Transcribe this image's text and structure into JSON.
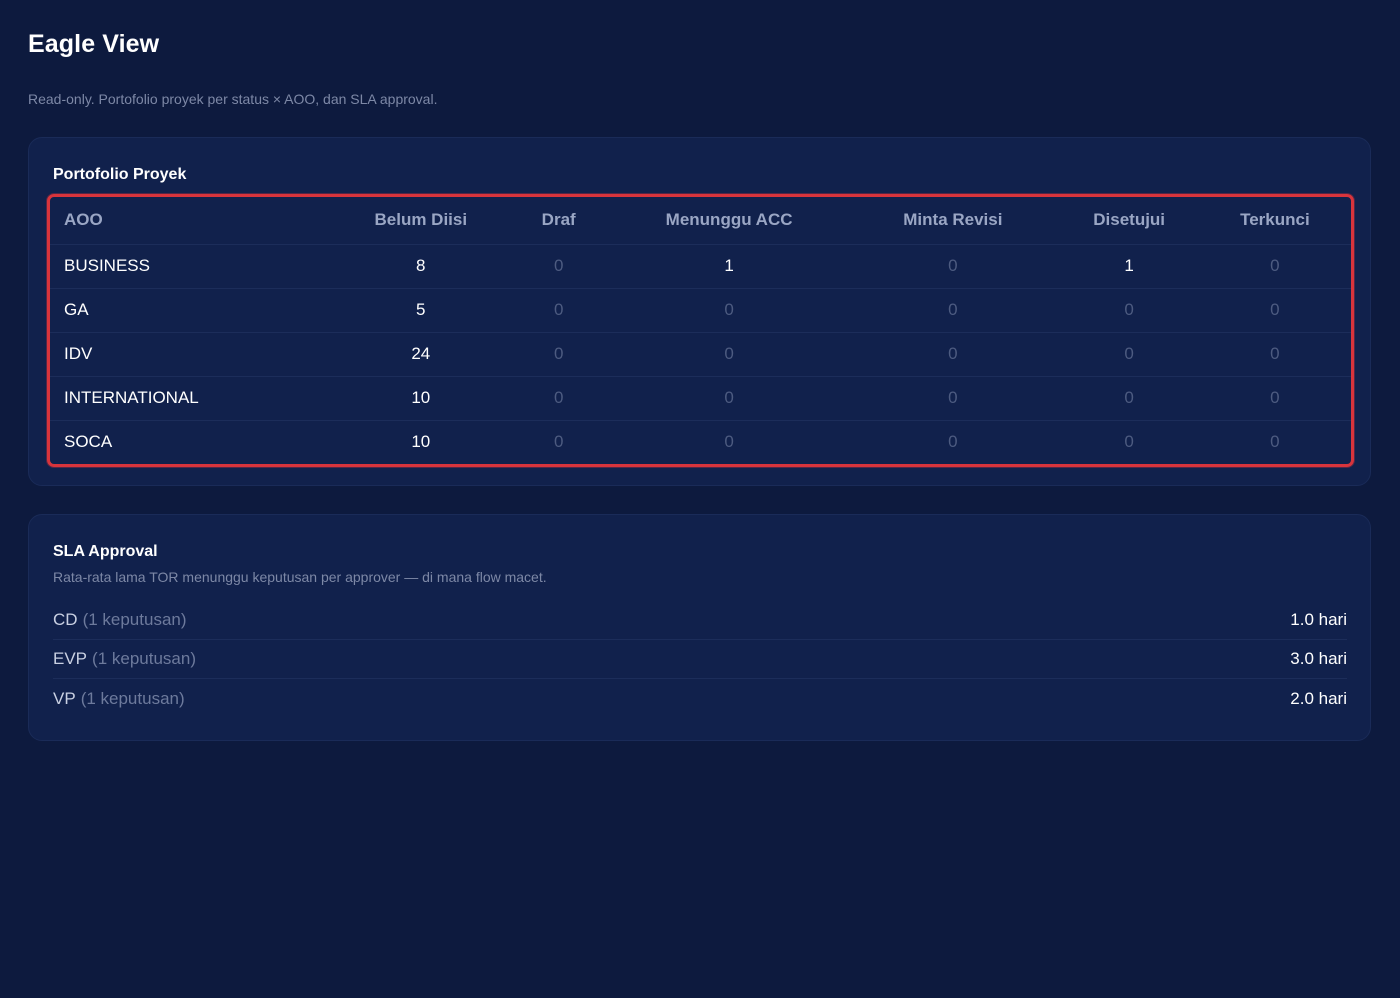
{
  "page": {
    "title": "Eagle View",
    "subtitle": "Read-only. Portofolio proyek per status × AOO, dan SLA approval."
  },
  "portfolio": {
    "title": "Portofolio Proyek",
    "columns": [
      "AOO",
      "Belum Diisi",
      "Draf",
      "Menunggu ACC",
      "Minta Revisi",
      "Disetujui",
      "Terkunci"
    ],
    "rows": [
      {
        "name": "BUSINESS",
        "values": [
          "8",
          "0",
          "1",
          "0",
          "1",
          "0"
        ]
      },
      {
        "name": "GA",
        "values": [
          "5",
          "0",
          "0",
          "0",
          "0",
          "0"
        ]
      },
      {
        "name": "IDV",
        "values": [
          "24",
          "0",
          "0",
          "0",
          "0",
          "0"
        ]
      },
      {
        "name": "INTERNATIONAL",
        "values": [
          "10",
          "0",
          "0",
          "0",
          "0",
          "0"
        ]
      },
      {
        "name": "SOCA",
        "values": [
          "10",
          "0",
          "0",
          "0",
          "0",
          "0"
        ]
      }
    ]
  },
  "sla": {
    "title": "SLA Approval",
    "description": "Rata-rata lama TOR menunggu keputusan per approver — di mana flow macet.",
    "items": [
      {
        "approver": "CD",
        "count": "(1 keputusan)",
        "value": "1.0 hari"
      },
      {
        "approver": "EVP",
        "count": "(1 keputusan)",
        "value": "3.0 hari"
      },
      {
        "approver": "VP",
        "count": "(1 keputusan)",
        "value": "2.0 hari"
      }
    ]
  },
  "colors": {
    "background": "#0d1a3e",
    "card": "#11214c",
    "highlight_border": "#d8343c",
    "muted_text": "#7d88a6"
  }
}
